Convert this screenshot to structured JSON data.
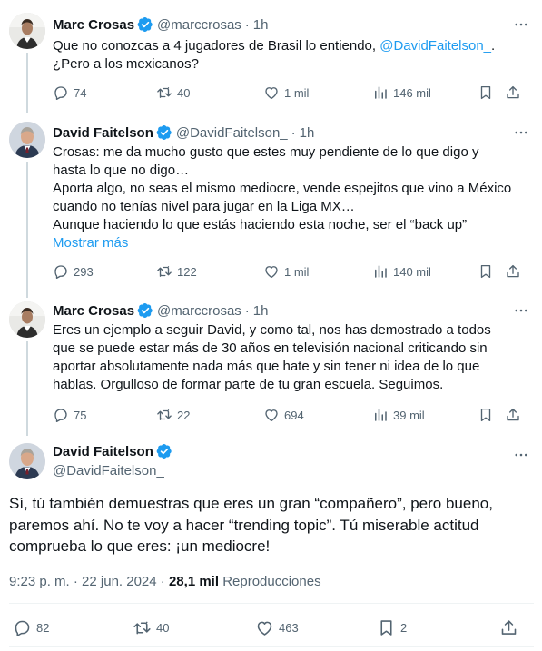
{
  "tweets": [
    {
      "name": "Marc Crosas",
      "handle": "@marccrosas",
      "time": "1h",
      "lines": [
        {
          "pre": "Que no conozcas a 4 jugadores de Brasil lo entiendo, ",
          "mention": "@DavidFaitelson_",
          "post": "."
        },
        {
          "pre": "¿Pero a los mexicanos?",
          "mention": "",
          "post": ""
        }
      ],
      "show_more": "",
      "replies": "74",
      "retweets": "40",
      "likes": "1 mil",
      "views": "146 mil"
    },
    {
      "name": "David Faitelson",
      "handle": "@DavidFaitelson_",
      "time": "1h",
      "lines": [
        {
          "pre": "Crosas: me da mucho gusto que estes muy pendiente de lo que digo y",
          "mention": "",
          "post": ""
        },
        {
          "pre": "hasta lo que no digo…",
          "mention": "",
          "post": ""
        },
        {
          "pre": "Aporta algo, no seas el mismo mediocre, vende espejitos que vino a México",
          "mention": "",
          "post": ""
        },
        {
          "pre": "cuando no tenías nivel para jugar en la Liga MX…",
          "mention": "",
          "post": ""
        },
        {
          "pre": "Aunque haciendo lo que estás haciendo esta noche, ser el “back up”",
          "mention": "",
          "post": ""
        }
      ],
      "show_more": "Mostrar más",
      "replies": "293",
      "retweets": "122",
      "likes": "1 mil",
      "views": "140 mil"
    },
    {
      "name": "Marc Crosas",
      "handle": "@marccrosas",
      "time": "1h",
      "lines": [
        {
          "pre": "Eres un ejemplo a seguir David, y como tal, nos has demostrado a todos",
          "mention": "",
          "post": ""
        },
        {
          "pre": "que se puede estar más de 30 años en televisión nacional criticando sin",
          "mention": "",
          "post": ""
        },
        {
          "pre": "aportar absolutamente nada más que hate y sin tener ni idea de lo que",
          "mention": "",
          "post": ""
        },
        {
          "pre": "hablas. Orgulloso de formar parte de tu gran escuela. Seguimos.",
          "mention": "",
          "post": ""
        }
      ],
      "show_more": "",
      "replies": "75",
      "retweets": "22",
      "likes": "694",
      "views": "39 mil"
    }
  ],
  "main": {
    "name": "David Faitelson",
    "handle": "@DavidFaitelson_",
    "lines": [
      "Sí, tú también demuestras que eres un gran “compañero”, pero bueno,",
      "paremos ahí. No te voy a hacer “trending topic”. Tú miserable actitud",
      "comprueba lo que eres: ¡un mediocre!"
    ],
    "time": "9:23 p. m.",
    "date": "22 jun. 2024",
    "views_count": "28,1 mil",
    "views_label": "Reproducciones",
    "replies": "82",
    "retweets": "40",
    "likes": "463",
    "bookmarks": "2"
  },
  "colors": {
    "accent": "#1d9bf0",
    "text": "#0f1419",
    "muted": "#536471",
    "thread_line": "#cfd9de"
  }
}
